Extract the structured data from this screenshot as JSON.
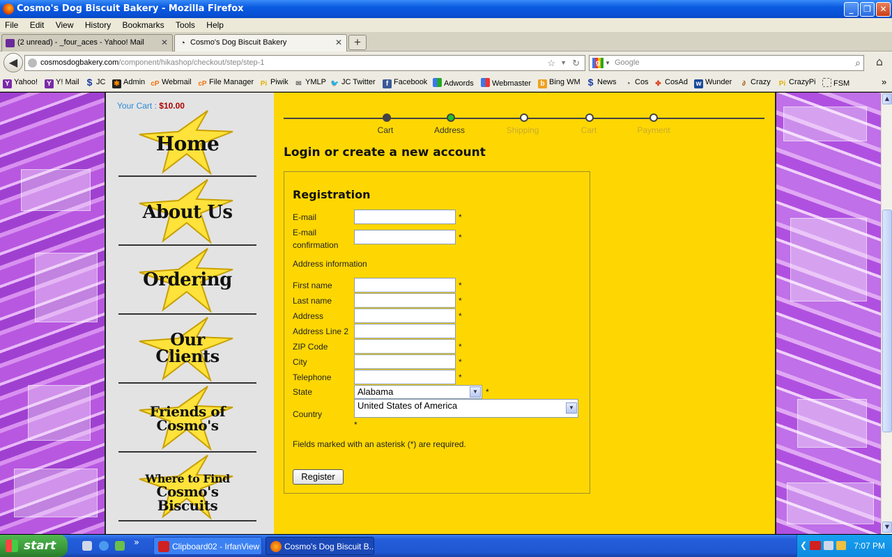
{
  "window": {
    "title": "Cosmo's Dog Biscuit Bakery - Mozilla Firefox"
  },
  "menu": [
    "File",
    "Edit",
    "View",
    "History",
    "Bookmarks",
    "Tools",
    "Help"
  ],
  "tabs": [
    {
      "label": "(2 unread) - _four_aces - Yahoo! Mail"
    },
    {
      "label": "Cosmo's Dog Biscuit Bakery"
    }
  ],
  "newtab_label": "+",
  "url": {
    "host": "cosmosdogbakery.com",
    "path": "/component/hikashop/checkout/step/step-1"
  },
  "search": {
    "placeholder": "Google"
  },
  "bookmarks": [
    "Yahoo!",
    "Y! Mail",
    "JC",
    "Admin",
    "Webmail",
    "File Manager",
    "Piwik",
    "YMLP",
    "JC Twitter",
    "Facebook",
    "Adwords",
    "Webmaster",
    "Bing WM",
    "News",
    "Cos",
    "CosAd",
    "Wunder",
    "Crazy",
    "CrazyPi",
    "FSM"
  ],
  "bookmarks_more": "»",
  "cart": {
    "label": "Your Cart :",
    "amount": "$10.00"
  },
  "nav": {
    "home": [
      "Home"
    ],
    "about": [
      "About Us"
    ],
    "ordering": [
      "Ordering"
    ],
    "clients": [
      "Our",
      "Clients"
    ],
    "friends": [
      "Friends of",
      "Cosmo's"
    ],
    "where": [
      "Where to Find",
      "Cosmo's",
      "Biscuits"
    ]
  },
  "steps": [
    {
      "label": "Cart",
      "state": "done"
    },
    {
      "label": "Address",
      "state": "current"
    },
    {
      "label": "Shipping",
      "state": "pending"
    },
    {
      "label": "Cart",
      "state": "pending"
    },
    {
      "label": "Payment",
      "state": "pending"
    }
  ],
  "page_heading": "Login or create a new account",
  "registration": {
    "heading": "Registration",
    "email_label": "E-mail",
    "email_confirm_label": [
      "E-mail",
      "confirmation"
    ],
    "address_info_label": "Address information",
    "first_name_label": "First name",
    "last_name_label": "Last name",
    "address_label": "Address",
    "address2_label": "Address Line 2",
    "zip_label": "ZIP Code",
    "city_label": "City",
    "telephone_label": "Telephone",
    "state_label": "State",
    "state_value": "Alabama",
    "country_label": "Country",
    "country_value": "United States of America",
    "required_mark": "*",
    "required_note": "Fields marked with an asterisk (*) are required.",
    "submit_label": "Register"
  },
  "colors": {
    "page_bg": "#fed702",
    "sidebar_bg": "#e3e3e3",
    "cart_label": "#2a8ad8",
    "cart_amount": "#b00000",
    "step_done": "#444444",
    "step_current": "#22c22a"
  },
  "taskbar": {
    "start_label": "start",
    "quicklaunch_more": "»",
    "buttons": [
      {
        "label": "Clipboard02 - IrfanView"
      },
      {
        "label": "Cosmo's Dog Biscuit B..."
      }
    ],
    "clock": "7:07 PM"
  }
}
